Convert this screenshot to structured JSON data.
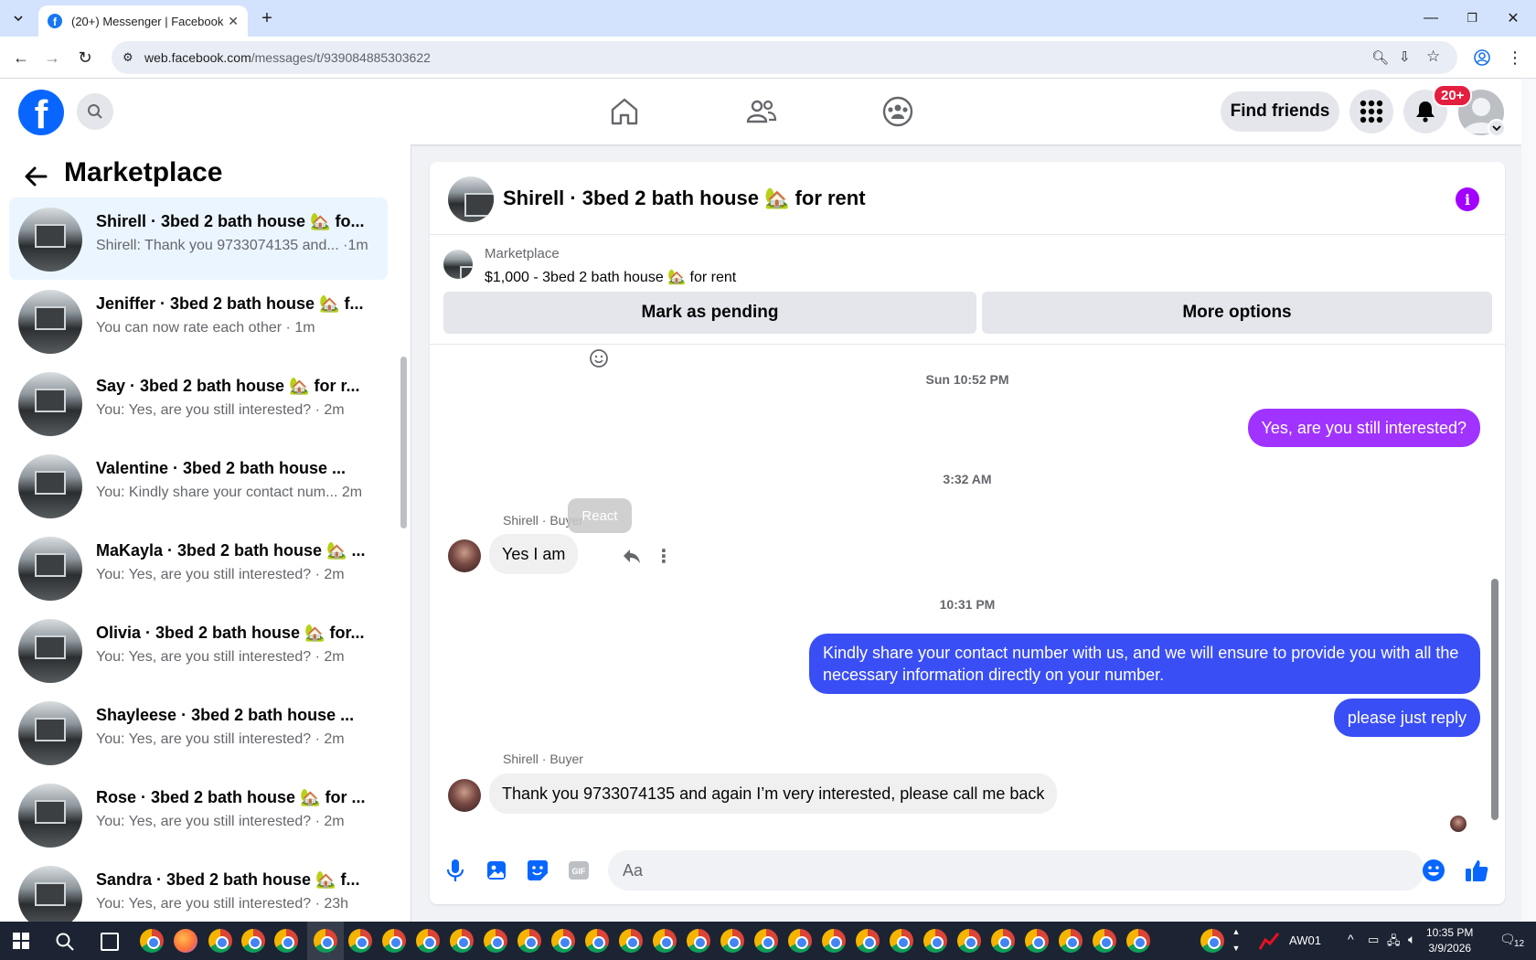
{
  "browser": {
    "tab_title": "(20+) Messenger | Facebook",
    "url_domain": "web.facebook.com",
    "url_path": "/messages/t/939084885303622"
  },
  "header": {
    "find_friends_label": "Find friends",
    "notification_badge": "20+"
  },
  "sidebar": {
    "title": "Marketplace",
    "conversations": [
      {
        "name": "Shirell · 3bed 2 bath house 🏡 fo...",
        "snippet": "Shirell: Thank you 9733074135 and... ·1m",
        "active": true
      },
      {
        "name": "Jeniffer · 3bed 2 bath house 🏡 f...",
        "snippet": "You can now rate each other · 1m"
      },
      {
        "name": "Say · 3bed 2 bath house 🏡 for r...",
        "snippet": "You: Yes, are you still interested? · 2m"
      },
      {
        "name": "Valentine · 3bed 2 bath house ...",
        "snippet": "You: Kindly share your contact num...  2m"
      },
      {
        "name": "MaKayla · 3bed 2 bath house 🏡 ...",
        "snippet": "You: Yes, are you still interested? · 2m"
      },
      {
        "name": "Olivia · 3bed 2 bath house 🏡 for...",
        "snippet": "You: Yes, are you still interested? · 2m"
      },
      {
        "name": "Shayleese · 3bed 2 bath house ...",
        "snippet": "You: Yes, are you still interested? · 2m"
      },
      {
        "name": "Rose · 3bed 2 bath house 🏡 for ...",
        "snippet": "You: Yes, are you still interested? · 2m"
      },
      {
        "name": "Sandra · 3bed 2 bath house 🏡 f...",
        "snippet": "You: Yes, are you still interested? · 23h"
      }
    ]
  },
  "chat": {
    "title": "Shirell · 3bed 2 bath house 🏡 for rent",
    "listing_source": "Marketplace",
    "listing_title": "$1,000 - 3bed 2 bath house 🏡 for rent",
    "mark_pending_label": "Mark as pending",
    "more_options_label": "More options",
    "ts1": "Sun 10:52 PM",
    "out1": "Yes, are you still interested?",
    "ts2": "3:32 AM",
    "sender1": "Shirell · Buyer",
    "react_tooltip": "React",
    "in1": "Yes I am",
    "ts3": "10:31 PM",
    "out2": "Kindly share your contact number with us, and we will ensure to provide you with all the necessary information directly on your number.",
    "out3": "please just reply",
    "sender2": "Shirell · Buyer",
    "in2": "Thank you 9733074135 and again I’m very interested, please call me back",
    "input_placeholder": "Aa"
  },
  "taskbar": {
    "clock_time": "10:35 PM",
    "clock_date": "3/9/2026",
    "app_label": "AW01",
    "notification_count": "12"
  },
  "colors": {
    "fb_blue": "#0866ff",
    "outgoing_purple": "#a033ff",
    "outgoing_blue": "#3a4ef5",
    "info_purple": "#a200ff"
  }
}
